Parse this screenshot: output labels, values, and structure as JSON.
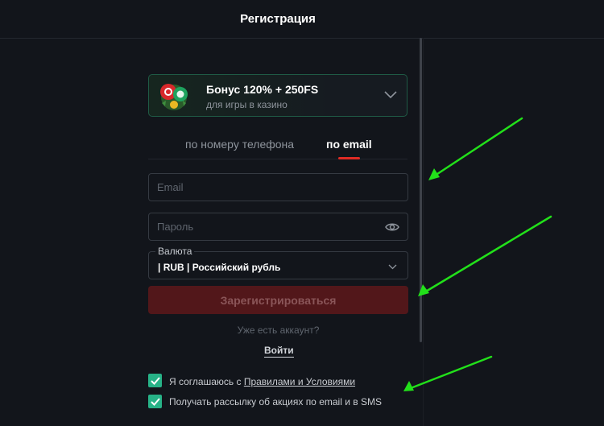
{
  "header": {
    "title": "Регистрация"
  },
  "bonus": {
    "title": "Бонус 120% + 250FS",
    "subtitle": "для игры в казино"
  },
  "tabs": [
    {
      "label": "по номеру телефона",
      "active": false
    },
    {
      "label": "по email",
      "active": true
    }
  ],
  "form": {
    "email_placeholder": "Email",
    "password_placeholder": "Пароль",
    "currency_label": "Валюта",
    "currency_value": "| RUB | Российский рубль",
    "register_label": "Зарегистрироваться",
    "has_account": "Уже есть аккаунт?",
    "login_label": "Войти"
  },
  "consents": {
    "terms_prefix": "Я соглашаюсь с ",
    "terms_link": "Правилами и Условиями",
    "newsletter": "Получать рассылку об акциях по email и в SMS"
  },
  "colors": {
    "background": "#12151b",
    "accent_red": "#e02b25",
    "checkbox_green": "#27b287",
    "annotation_arrow": "#22e01a"
  }
}
